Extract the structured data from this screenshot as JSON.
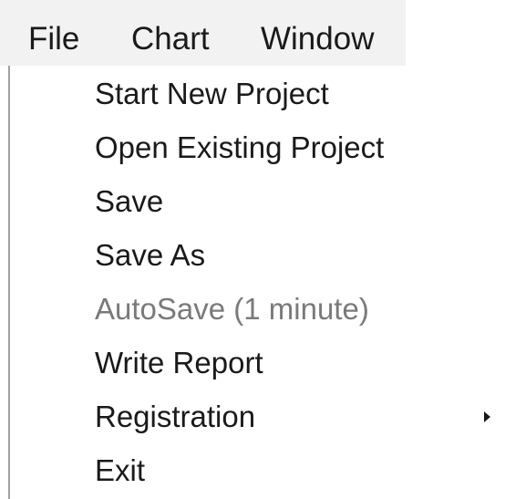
{
  "menubar": {
    "items": [
      {
        "label": "File"
      },
      {
        "label": "Chart"
      },
      {
        "label": "Window"
      }
    ]
  },
  "file_menu": {
    "items": [
      {
        "label": "Start New Project",
        "enabled": true
      },
      {
        "label": "Open Existing Project",
        "enabled": true
      },
      {
        "label": "Save",
        "enabled": true
      },
      {
        "label": "Save As",
        "enabled": true
      },
      {
        "label": "AutoSave (1 minute)",
        "enabled": false
      },
      {
        "label": "Write Report",
        "enabled": true
      },
      {
        "label": "Registration",
        "enabled": true,
        "submenu": true,
        "submenu_icon": "chevron-right-icon"
      },
      {
        "label": "Exit",
        "enabled": true
      }
    ]
  }
}
